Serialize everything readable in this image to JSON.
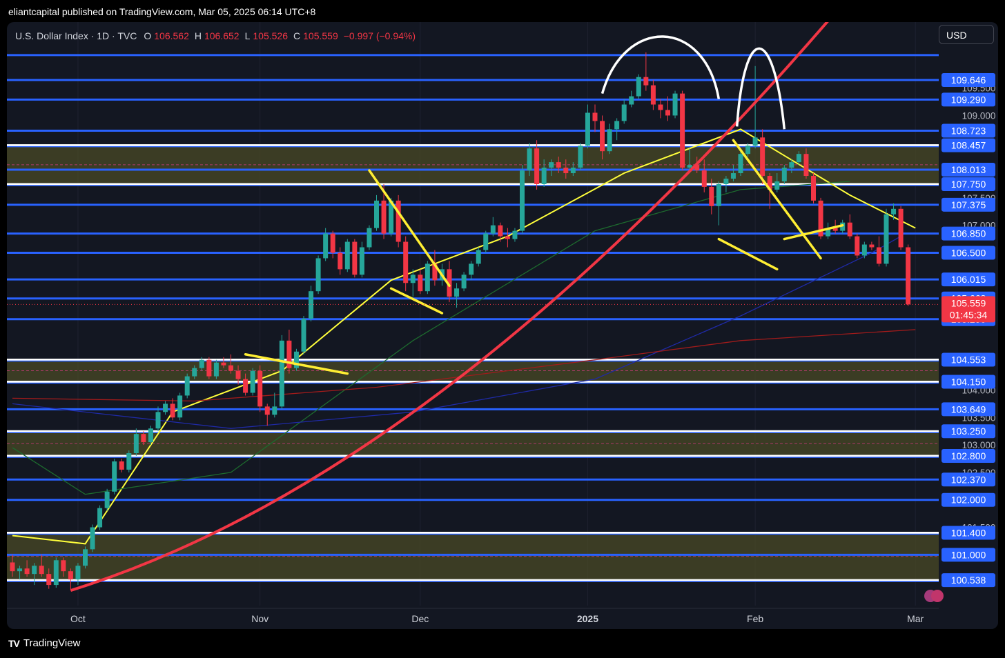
{
  "header": {
    "publish_line": "eliantcapital published on TradingView.com, Mar 05, 2025 06:14 UTC+8"
  },
  "legend": {
    "symbol": "U.S. Dollar Index · 1D · TVC",
    "o_label": "O",
    "o_value": "106.562",
    "h_label": "H",
    "h_value": "106.652",
    "l_label": "L",
    "l_value": "105.526",
    "c_label": "C",
    "c_value": "105.559",
    "change": "−0.997 (−0.94%)"
  },
  "currency_button": "USD",
  "footer": {
    "brand": "TradingView"
  },
  "colors": {
    "up": "#26a69a",
    "down": "#f23645",
    "level_line": "#2962ff",
    "zone": "#4a4a26",
    "trend_red": "#f23645",
    "ema_yellow": "#ffff3b",
    "ma_blue": "#1f2aa6",
    "ma_darkred": "#a11b1b",
    "ma_green": "#1d6b2e",
    "annotation_yellow": "#ffee33",
    "annotation_white": "#ffffff"
  },
  "chart_data": {
    "type": "candlestick",
    "title": "U.S. Dollar Index · 1D · TVC",
    "x_tick_labels": [
      "Oct",
      "Nov",
      "Dec",
      "2025",
      "Feb",
      "Mar"
    ],
    "y_grey_ticks": [
      "109.500",
      "109.000",
      "107.500",
      "107.000",
      "106.000",
      "104.000",
      "103.500",
      "103.000",
      "102.500",
      "101.500"
    ],
    "ylim": [
      100.2,
      110.4
    ],
    "last_price": "105.559",
    "countdown": "01:45:34",
    "horizontal_levels": [
      {
        "value": 110.1,
        "label": ""
      },
      {
        "value": 109.646,
        "label": "109.646"
      },
      {
        "value": 109.29,
        "label": "109.290"
      },
      {
        "value": 108.723,
        "label": "108.723"
      },
      {
        "value": 108.457,
        "label": "108.457"
      },
      {
        "value": 108.013,
        "label": "108.013"
      },
      {
        "value": 107.75,
        "label": "107.750"
      },
      {
        "value": 107.375,
        "label": "107.375"
      },
      {
        "value": 106.85,
        "label": "106.850"
      },
      {
        "value": 106.5,
        "label": "106.500"
      },
      {
        "value": 106.015,
        "label": "106.015"
      },
      {
        "value": 105.668,
        "label": "105.668"
      },
      {
        "value": 105.29,
        "label": "105.290"
      },
      {
        "value": 104.553,
        "label": "104.553"
      },
      {
        "value": 104.15,
        "label": "104.150"
      },
      {
        "value": 103.649,
        "label": "103.649"
      },
      {
        "value": 103.25,
        "label": "103.250"
      },
      {
        "value": 102.8,
        "label": "102.800"
      },
      {
        "value": 102.37,
        "label": "102.370"
      },
      {
        "value": 102.0,
        "label": "102.000"
      },
      {
        "value": 101.4,
        "label": "101.400"
      },
      {
        "value": 101.0,
        "label": "101.000"
      },
      {
        "value": 100.538,
        "label": "100.538"
      }
    ],
    "zones": [
      {
        "from": 107.75,
        "to": 108.457
      },
      {
        "from": 104.15,
        "to": 104.553
      },
      {
        "from": 102.8,
        "to": 103.25
      },
      {
        "from": 100.538,
        "to": 101.4
      }
    ],
    "candles": [
      [
        100.86,
        101.0,
        100.6,
        100.7
      ],
      [
        100.7,
        100.8,
        100.55,
        100.75
      ],
      [
        100.75,
        100.9,
        100.6,
        100.65
      ],
      [
        100.65,
        100.85,
        100.45,
        100.8
      ],
      [
        100.8,
        101.0,
        100.6,
        100.65
      ],
      [
        100.65,
        100.75,
        100.38,
        100.45
      ],
      [
        100.45,
        100.95,
        100.4,
        100.9
      ],
      [
        100.9,
        100.95,
        100.6,
        100.7
      ],
      [
        100.7,
        100.75,
        100.35,
        100.55
      ],
      [
        100.55,
        100.85,
        100.45,
        100.8
      ],
      [
        100.8,
        101.15,
        100.75,
        101.1
      ],
      [
        101.1,
        101.55,
        101.05,
        101.5
      ],
      [
        101.5,
        101.9,
        101.45,
        101.85
      ],
      [
        101.85,
        102.2,
        101.8,
        102.15
      ],
      [
        102.15,
        102.75,
        102.1,
        102.7
      ],
      [
        102.7,
        102.75,
        102.5,
        102.55
      ],
      [
        102.55,
        102.9,
        102.5,
        102.85
      ],
      [
        102.85,
        103.3,
        102.8,
        103.2
      ],
      [
        103.2,
        103.25,
        103.0,
        103.05
      ],
      [
        103.05,
        103.35,
        103.0,
        103.3
      ],
      [
        103.3,
        103.7,
        103.25,
        103.6
      ],
      [
        103.6,
        103.8,
        103.55,
        103.75
      ],
      [
        103.75,
        103.85,
        103.45,
        103.5
      ],
      [
        103.5,
        103.95,
        103.45,
        103.9
      ],
      [
        103.9,
        104.3,
        103.85,
        104.25
      ],
      [
        104.25,
        104.45,
        104.2,
        104.4
      ],
      [
        104.4,
        104.6,
        104.35,
        104.55
      ],
      [
        104.55,
        104.6,
        104.2,
        104.25
      ],
      [
        104.25,
        104.55,
        104.2,
        104.5
      ],
      [
        104.5,
        104.6,
        104.4,
        104.45
      ],
      [
        104.45,
        104.65,
        104.3,
        104.35
      ],
      [
        104.35,
        104.45,
        104.1,
        104.2
      ],
      [
        104.2,
        104.3,
        103.9,
        103.95
      ],
      [
        103.95,
        104.4,
        103.9,
        104.35
      ],
      [
        104.35,
        104.45,
        103.6,
        103.7
      ],
      [
        103.7,
        103.75,
        103.35,
        103.55
      ],
      [
        103.55,
        103.95,
        103.5,
        103.7
      ],
      [
        103.7,
        105.0,
        103.65,
        104.9
      ],
      [
        104.9,
        105.1,
        104.3,
        104.4
      ],
      [
        104.4,
        104.75,
        104.35,
        104.7
      ],
      [
        104.7,
        105.35,
        104.65,
        105.3
      ],
      [
        105.3,
        105.9,
        105.25,
        105.8
      ],
      [
        105.8,
        106.45,
        105.75,
        106.4
      ],
      [
        106.4,
        106.95,
        106.35,
        106.85
      ],
      [
        106.85,
        106.9,
        106.4,
        106.5
      ],
      [
        106.5,
        106.6,
        106.1,
        106.2
      ],
      [
        106.2,
        106.75,
        106.15,
        106.7
      ],
      [
        106.7,
        106.75,
        106.05,
        106.1
      ],
      [
        106.1,
        106.7,
        106.05,
        106.6
      ],
      [
        106.6,
        107.0,
        106.55,
        106.95
      ],
      [
        106.95,
        107.55,
        106.9,
        107.45
      ],
      [
        107.45,
        107.75,
        106.75,
        106.85
      ],
      [
        106.85,
        107.5,
        106.8,
        107.45
      ],
      [
        107.45,
        107.55,
        106.6,
        106.7
      ],
      [
        106.7,
        106.8,
        105.8,
        105.95
      ],
      [
        105.95,
        106.2,
        105.7,
        106.1
      ],
      [
        106.1,
        106.2,
        105.75,
        105.8
      ],
      [
        105.8,
        106.35,
        105.75,
        106.3
      ],
      [
        106.3,
        106.55,
        105.9,
        106.0
      ],
      [
        106.0,
        106.3,
        105.9,
        106.2
      ],
      [
        106.2,
        106.35,
        105.6,
        105.7
      ],
      [
        105.7,
        105.95,
        105.5,
        105.85
      ],
      [
        105.85,
        106.15,
        105.8,
        106.1
      ],
      [
        106.1,
        106.35,
        106.0,
        106.3
      ],
      [
        106.3,
        106.6,
        106.25,
        106.55
      ],
      [
        106.55,
        106.9,
        106.5,
        106.85
      ],
      [
        106.85,
        107.15,
        106.8,
        107.0
      ],
      [
        107.0,
        107.05,
        106.7,
        106.8
      ],
      [
        106.8,
        106.95,
        106.6,
        106.75
      ],
      [
        106.75,
        106.95,
        106.7,
        106.9
      ],
      [
        106.9,
        108.1,
        106.85,
        108.0
      ],
      [
        108.0,
        108.5,
        107.9,
        108.4
      ],
      [
        108.4,
        108.55,
        107.65,
        107.75
      ],
      [
        107.75,
        108.2,
        107.7,
        108.05
      ],
      [
        108.05,
        108.2,
        107.9,
        108.15
      ],
      [
        108.15,
        108.25,
        107.95,
        108.05
      ],
      [
        108.05,
        108.2,
        107.85,
        107.95
      ],
      [
        107.95,
        108.15,
        107.9,
        108.05
      ],
      [
        108.05,
        108.5,
        108.0,
        108.45
      ],
      [
        108.45,
        109.2,
        108.4,
        109.05
      ],
      [
        109.05,
        109.2,
        108.7,
        108.9
      ],
      [
        108.9,
        109.0,
        108.2,
        108.35
      ],
      [
        108.35,
        108.85,
        108.3,
        108.75
      ],
      [
        108.75,
        108.95,
        108.55,
        108.9
      ],
      [
        108.9,
        109.3,
        108.85,
        109.2
      ],
      [
        109.2,
        109.45,
        109.15,
        109.35
      ],
      [
        109.35,
        109.75,
        109.3,
        109.7
      ],
      [
        109.7,
        110.15,
        109.45,
        109.55
      ],
      [
        109.55,
        109.65,
        109.1,
        109.2
      ],
      [
        109.2,
        109.3,
        108.95,
        109.1
      ],
      [
        109.1,
        109.35,
        108.9,
        109.0
      ],
      [
        109.0,
        109.45,
        108.95,
        109.4
      ],
      [
        109.4,
        109.45,
        108.0,
        108.05
      ],
      [
        108.05,
        108.4,
        107.95,
        108.1
      ],
      [
        108.1,
        108.25,
        107.95,
        108.0
      ],
      [
        108.0,
        108.2,
        107.6,
        107.7
      ],
      [
        107.7,
        107.85,
        107.2,
        107.35
      ],
      [
        107.35,
        107.8,
        107.0,
        107.75
      ],
      [
        107.75,
        107.9,
        107.6,
        107.85
      ],
      [
        107.85,
        108.1,
        107.8,
        107.95
      ],
      [
        107.95,
        108.35,
        107.9,
        108.3
      ],
      [
        108.3,
        108.5,
        108.25,
        108.45
      ],
      [
        108.45,
        109.9,
        108.4,
        108.6
      ],
      [
        108.6,
        108.75,
        107.75,
        107.9
      ],
      [
        107.9,
        107.95,
        107.3,
        107.65
      ],
      [
        107.65,
        107.95,
        107.6,
        107.8
      ],
      [
        107.8,
        108.1,
        107.75,
        108.05
      ],
      [
        108.05,
        108.2,
        107.95,
        108.15
      ],
      [
        108.15,
        108.35,
        108.1,
        108.3
      ],
      [
        108.3,
        108.4,
        107.85,
        107.9
      ],
      [
        107.9,
        107.95,
        107.4,
        107.45
      ],
      [
        107.45,
        107.5,
        106.75,
        106.8
      ],
      [
        106.8,
        107.05,
        106.75,
        106.95
      ],
      [
        106.95,
        107.1,
        106.85,
        106.9
      ],
      [
        106.9,
        107.1,
        106.85,
        107.05
      ],
      [
        107.05,
        107.2,
        106.75,
        106.8
      ],
      [
        106.8,
        106.85,
        106.4,
        106.45
      ],
      [
        106.45,
        106.7,
        106.4,
        106.65
      ],
      [
        106.65,
        106.7,
        106.55,
        106.6
      ],
      [
        106.6,
        106.8,
        106.25,
        106.3
      ],
      [
        106.3,
        107.3,
        106.25,
        107.2
      ],
      [
        107.2,
        107.4,
        107.1,
        107.3
      ],
      [
        107.3,
        107.35,
        106.55,
        106.6
      ],
      [
        106.6,
        106.65,
        105.53,
        105.559
      ]
    ],
    "moving_averages": [
      {
        "color_key": "ema_yellow",
        "points": [
          [
            0,
            101.35
          ],
          [
            10,
            101.2
          ],
          [
            22,
            103.6
          ],
          [
            37,
            104.35
          ],
          [
            52,
            106.0
          ],
          [
            68,
            106.8
          ],
          [
            84,
            107.95
          ],
          [
            100,
            108.75
          ],
          [
            115,
            107.55
          ],
          [
            124,
            106.95
          ]
        ]
      },
      {
        "color_key": "ma_green",
        "points": [
          [
            0,
            102.95
          ],
          [
            10,
            102.1
          ],
          [
            30,
            102.5
          ],
          [
            55,
            104.9
          ],
          [
            80,
            106.9
          ],
          [
            100,
            107.65
          ],
          [
            115,
            107.8
          ]
        ]
      },
      {
        "color_key": "ma_blue",
        "points": [
          [
            0,
            103.75
          ],
          [
            30,
            103.3
          ],
          [
            55,
            103.6
          ],
          [
            80,
            104.2
          ],
          [
            100,
            105.35
          ],
          [
            118,
            106.5
          ],
          [
            122,
            106.8
          ]
        ]
      },
      {
        "color_key": "ma_darkred",
        "points": [
          [
            0,
            103.85
          ],
          [
            25,
            103.8
          ],
          [
            50,
            104.05
          ],
          [
            80,
            104.55
          ],
          [
            100,
            104.9
          ],
          [
            124,
            105.1
          ]
        ]
      }
    ],
    "annotations": [
      {
        "kind": "curve",
        "color_key": "trend_red",
        "from": [
          8,
          100.35
        ],
        "ctrl": [
          60,
          102.5
        ],
        "to": [
          117,
          111.5
        ]
      },
      {
        "kind": "line",
        "color_key": "annotation_yellow",
        "from": [
          32,
          104.65
        ],
        "to": [
          46,
          104.3
        ]
      },
      {
        "kind": "line",
        "color_key": "annotation_yellow",
        "from": [
          49,
          108.0
        ],
        "to": [
          60,
          105.9
        ]
      },
      {
        "kind": "line",
        "color_key": "annotation_yellow",
        "from": [
          52,
          105.85
        ],
        "to": [
          59,
          105.4
        ]
      },
      {
        "kind": "line",
        "color_key": "annotation_yellow",
        "from": [
          99,
          108.55
        ],
        "to": [
          111,
          106.4
        ]
      },
      {
        "kind": "line",
        "color_key": "annotation_yellow",
        "from": [
          97,
          106.75
        ],
        "to": [
          105,
          106.2
        ]
      },
      {
        "kind": "line",
        "color_key": "annotation_yellow",
        "from": [
          106,
          106.75
        ],
        "to": [
          114,
          107.0
        ]
      }
    ]
  }
}
